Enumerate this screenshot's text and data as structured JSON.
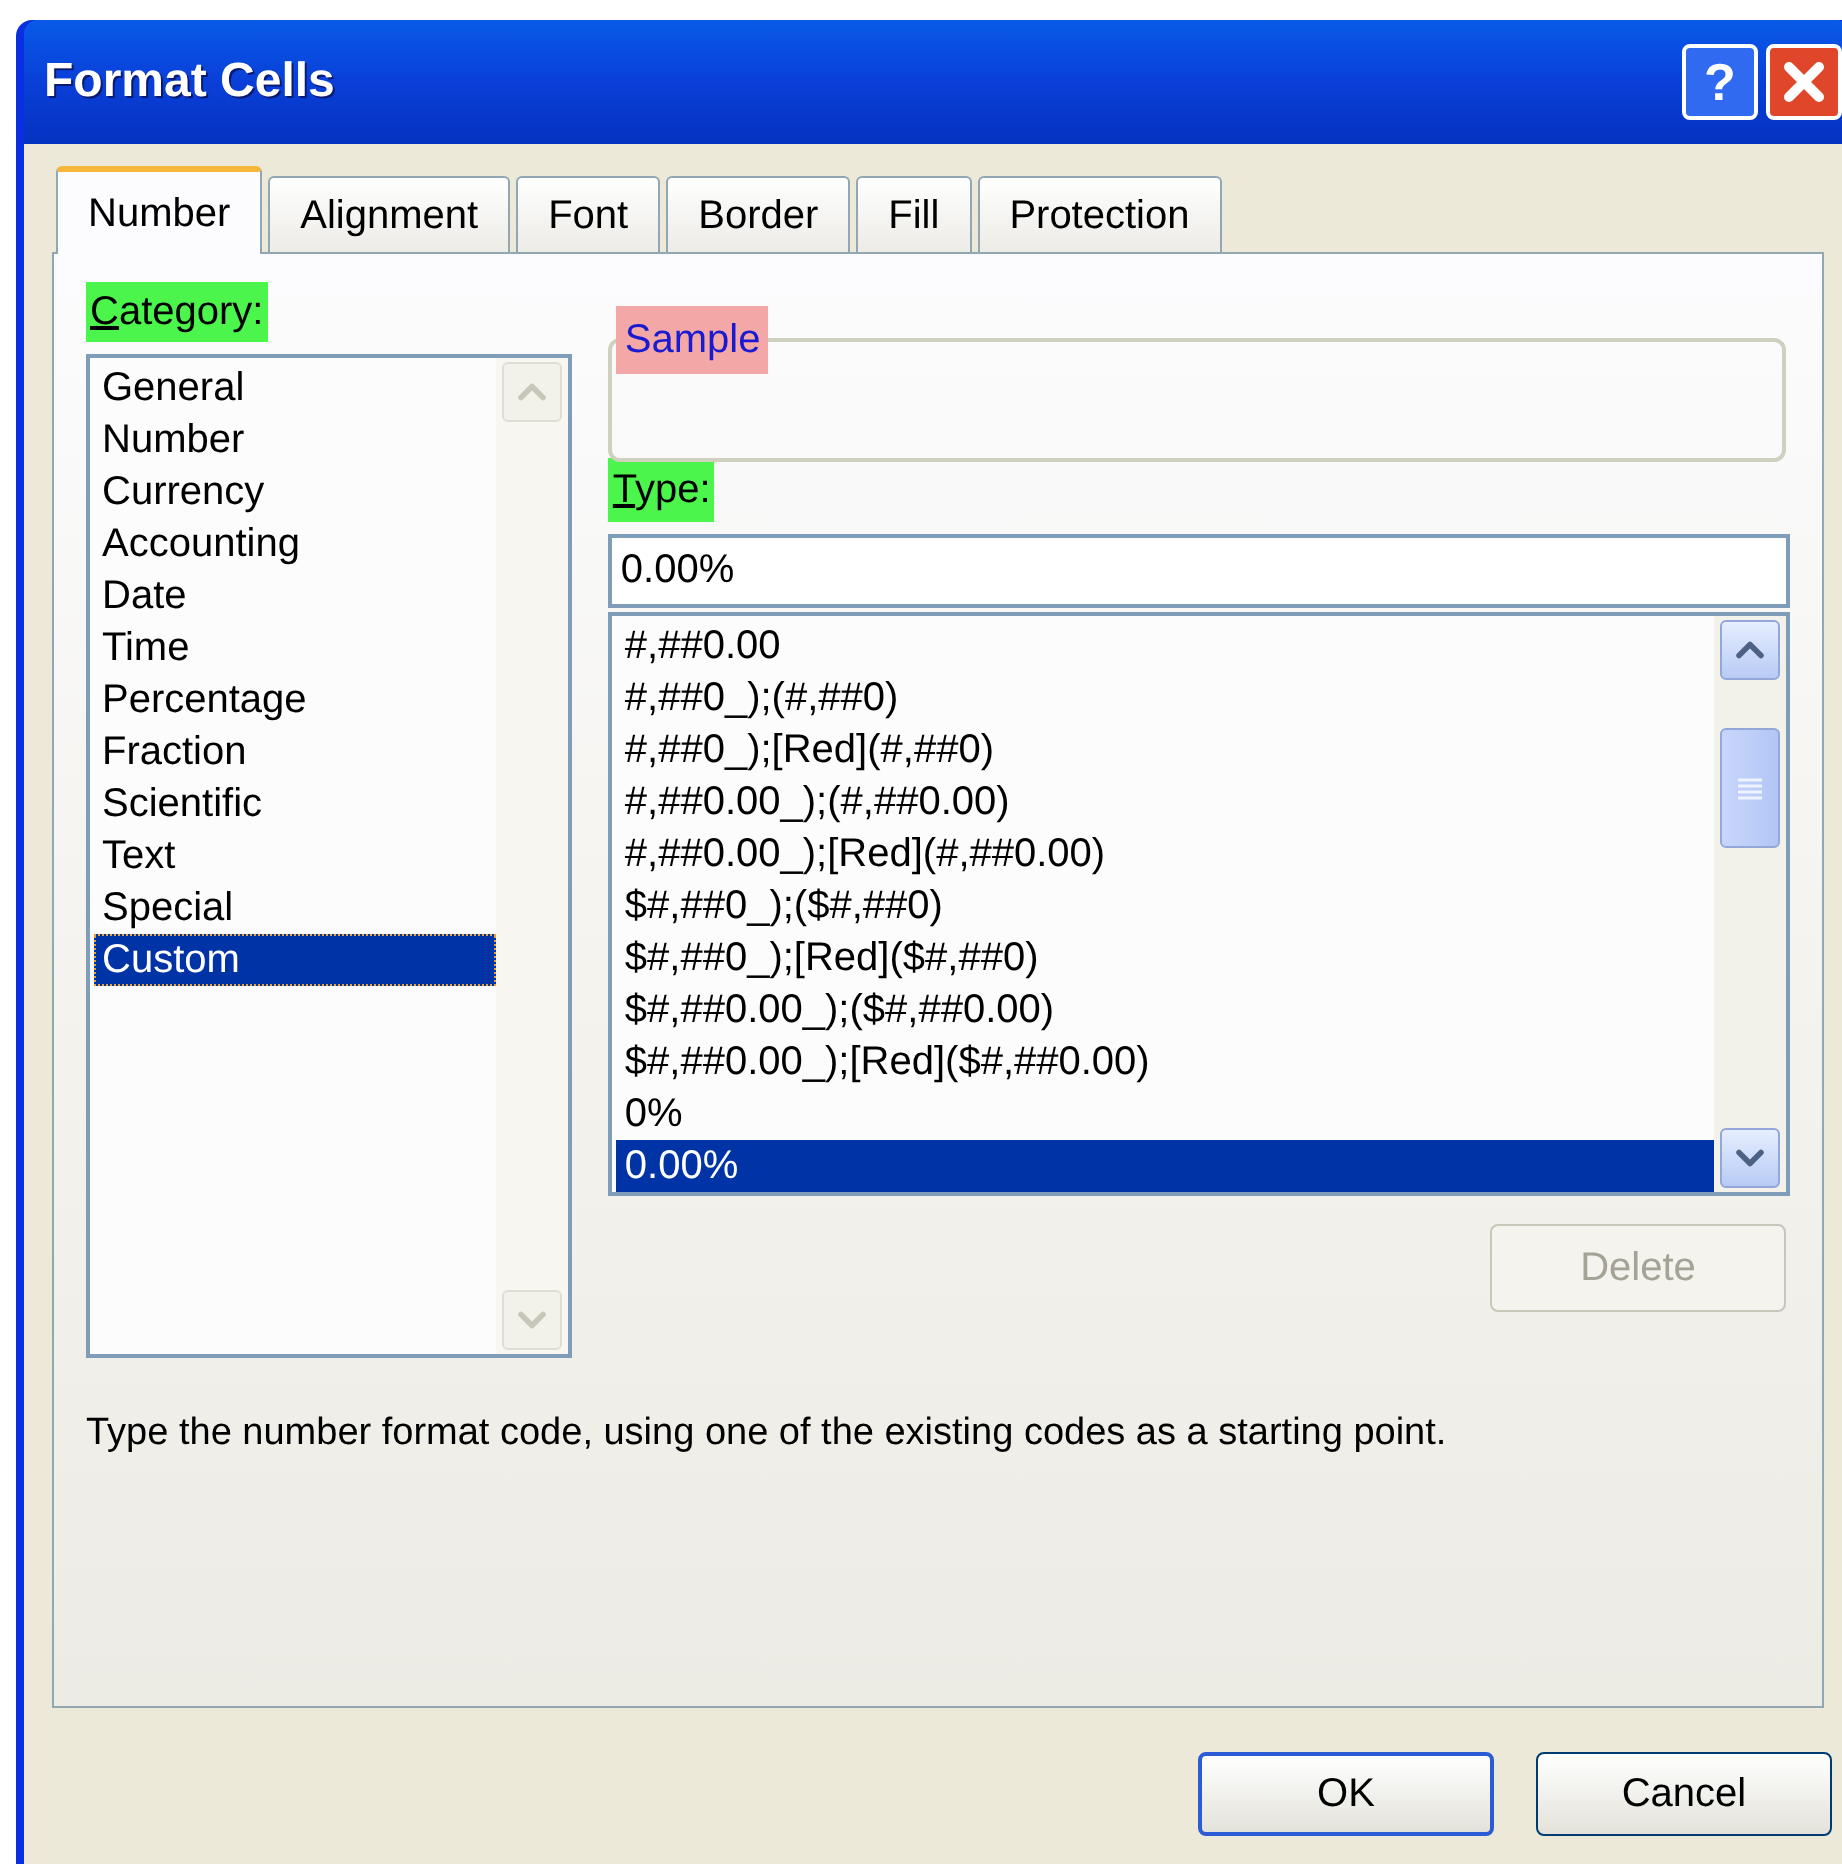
{
  "window": {
    "title": "Format Cells",
    "help_label": "?"
  },
  "tabs": [
    {
      "label": "Number",
      "selected": true
    },
    {
      "label": "Alignment",
      "selected": false
    },
    {
      "label": "Font",
      "selected": false
    },
    {
      "label": "Border",
      "selected": false
    },
    {
      "label": "Fill",
      "selected": false
    },
    {
      "label": "Protection",
      "selected": false
    }
  ],
  "category": {
    "label": "Category:",
    "items": [
      {
        "label": "General",
        "selected": false
      },
      {
        "label": "Number",
        "selected": false
      },
      {
        "label": "Currency",
        "selected": false
      },
      {
        "label": "Accounting",
        "selected": false
      },
      {
        "label": "Date",
        "selected": false
      },
      {
        "label": "Time",
        "selected": false
      },
      {
        "label": "Percentage",
        "selected": false
      },
      {
        "label": "Fraction",
        "selected": false
      },
      {
        "label": "Scientific",
        "selected": false
      },
      {
        "label": "Text",
        "selected": false
      },
      {
        "label": "Special",
        "selected": false
      },
      {
        "label": "Custom",
        "selected": true
      }
    ]
  },
  "sample": {
    "label": "Sample"
  },
  "type": {
    "label": "Type:",
    "value": "0.00%"
  },
  "formats": [
    {
      "label": "#,##0.00",
      "selected": false
    },
    {
      "label": "#,##0_);(#,##0)",
      "selected": false
    },
    {
      "label": "#,##0_);[Red](#,##0)",
      "selected": false
    },
    {
      "label": "#,##0.00_);(#,##0.00)",
      "selected": false
    },
    {
      "label": "#,##0.00_);[Red](#,##0.00)",
      "selected": false
    },
    {
      "label": "$#,##0_);($#,##0)",
      "selected": false
    },
    {
      "label": "$#,##0_);[Red]($#,##0)",
      "selected": false
    },
    {
      "label": "$#,##0.00_);($#,##0.00)",
      "selected": false
    },
    {
      "label": "$#,##0.00_);[Red]($#,##0.00)",
      "selected": false
    },
    {
      "label": "0%",
      "selected": false
    },
    {
      "label": "0.00%",
      "selected": true
    }
  ],
  "delete_button": {
    "label": "Delete",
    "disabled": true
  },
  "description": "Type the number format code, using one of the existing codes as a starting point.",
  "buttons": [
    {
      "label": "OK",
      "default": true
    },
    {
      "label": "Cancel",
      "default": false
    }
  ]
}
